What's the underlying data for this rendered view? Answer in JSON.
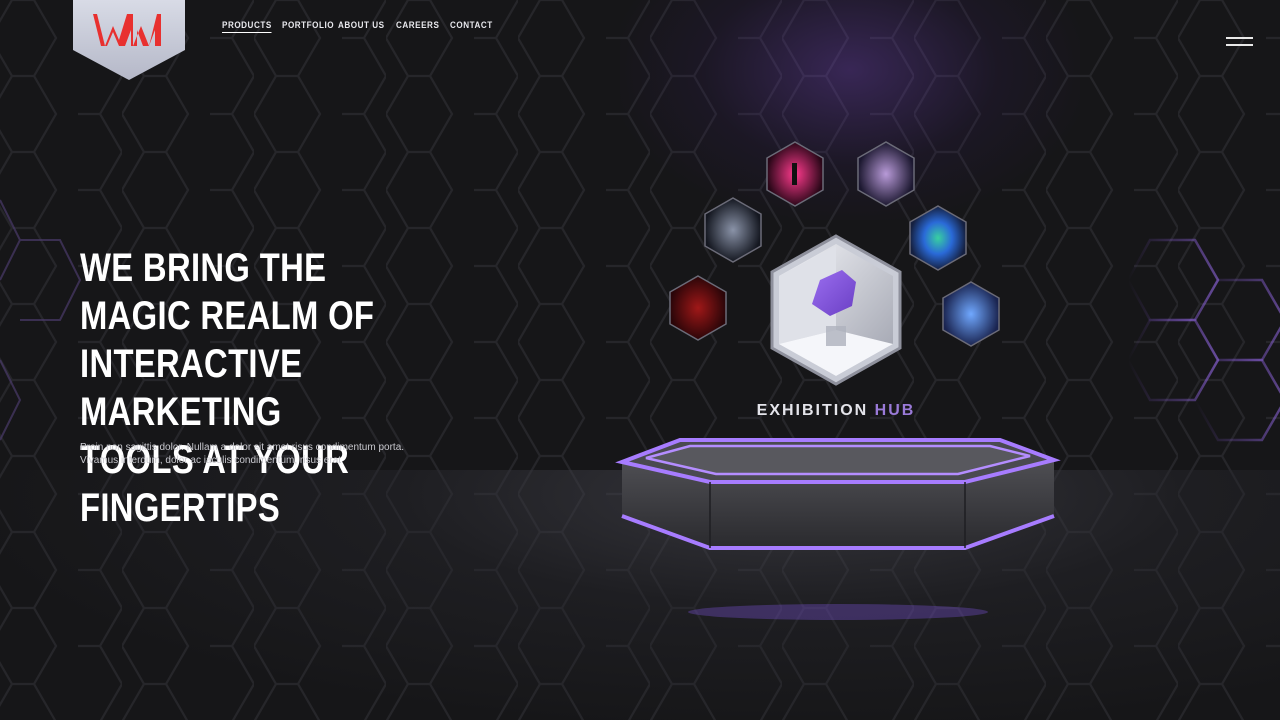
{
  "brand": {
    "logo_text": "WM",
    "accent_color": "#e8302f",
    "primary_purple": "#8a5ae0"
  },
  "nav": {
    "items": [
      {
        "label": "PRODUCTS",
        "active": true
      },
      {
        "label": "PORTFOLIO",
        "active": false
      },
      {
        "label": "ABOUT US",
        "active": false
      },
      {
        "label": "CAREERS",
        "active": false
      },
      {
        "label": "CONTACT",
        "active": false
      }
    ],
    "menu_icon": "hamburger-icon"
  },
  "hero": {
    "title": "WE BRING THE MAGIC REALM OF INTERACTIVE MARKETING TOOLS AT YOUR FINGERTIPS",
    "text": "Proin non sagittis dolor. Nullam a dolor sit amet risus condimentum porta. Vivamus interdum, dolor ac iaculis condimentum, risus erat"
  },
  "showcase": {
    "label_main": "EXHIBITION",
    "label_accent": "HUB",
    "thumbnails": [
      {
        "name": "red-tunnel-thumbnail"
      },
      {
        "name": "dark-corridor-thumbnail"
      },
      {
        "name": "neon-figure-thumbnail"
      },
      {
        "name": "touch-cloud-thumbnail"
      },
      {
        "name": "colorful-map-thumbnail"
      },
      {
        "name": "blue-art-thumbnail"
      }
    ]
  }
}
